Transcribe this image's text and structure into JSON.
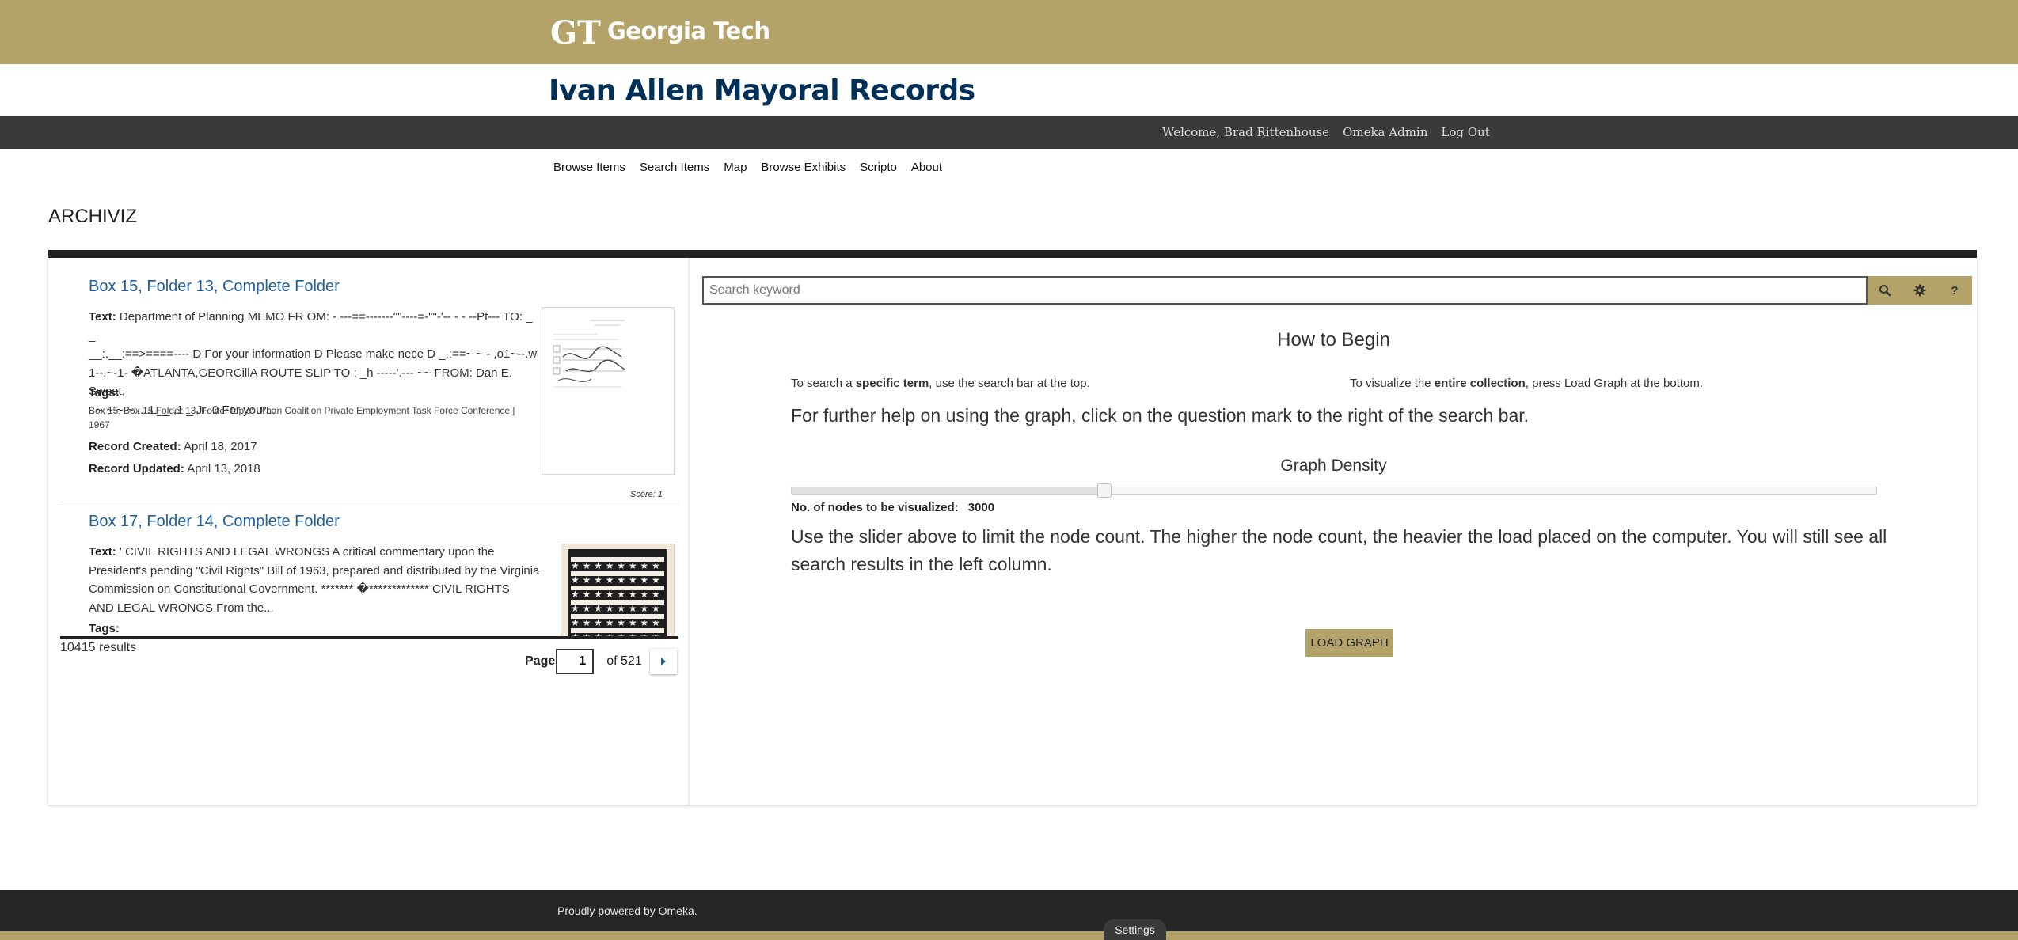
{
  "banner": {
    "logo_text": "Georgia Tech",
    "logo_mark": "GT"
  },
  "site": {
    "title": "Ivan Allen Mayoral Records"
  },
  "user_bar": {
    "welcome": "Welcome, Brad Rittenhouse",
    "admin": "Omeka Admin",
    "logout": "Log Out"
  },
  "nav": [
    "Browse Items",
    "Search Items",
    "Map",
    "Browse Exhibits",
    "Scripto",
    "About"
  ],
  "app": {
    "title": "ARCHIVIZ"
  },
  "results": [
    {
      "title": "Box 15, Folder 13, Complete Folder",
      "text_label": "Text:",
      "text_lines": [
        "Department of Planning MEMO FR OM: - ---==-------\"\"----=-\"\"-'-- - - --Pt--- TO: _ _",
        "__:.__:==>====---- D For your information D Please make nece D _.:==~ ~ - ,o1~--.w",
        "1--.~-1- �ATLANTA,GEORCillA ROUTE SLIP TO : _h -----'.--- ~~ FROM: Dan E. Sweat,",
        "- ~ ~ ~ ~ ....L__ ,1 _ Jr. 0 For your..."
      ],
      "tags_label": "Tags:",
      "tags_lines": [
        "Box 15, Box 15 Folder 13, Folder topic: Urban Coalition Private Employment Task Force Conference |",
        "1967"
      ],
      "created_label": "Record Created:",
      "created": "April 18, 2017",
      "updated_label": "Record Updated:",
      "updated": "April 13, 2018",
      "score": "Score: 1"
    },
    {
      "title": "Box 17, Folder 14, Complete Folder",
      "text_label": "Text:",
      "text_lines": [
        "' CIVIL RIGHTS AND LEGAL WRONGS A critical commentary upon the",
        "President's pending \"Civil Rights\" Bill of 1963, prepared and distributed by the Virginia",
        "Commission on Constitutional Government. ******* �************* CIVIL RIGHTS",
        "AND LEGAL WRONGS From the..."
      ],
      "tags_label": "Tags:"
    }
  ],
  "results_summary": {
    "count": "10415 results"
  },
  "pager": {
    "label": "Page",
    "current": "1",
    "of": "of 521"
  },
  "search": {
    "placeholder": "Search keyword",
    "search_icon": "search-icon",
    "settings_icon": "gear-icon",
    "help_label": "?"
  },
  "how_to_begin": {
    "title": "How to Begin",
    "hint_left_pre": "To search a ",
    "hint_left_bold": "specific term",
    "hint_left_post": ", use the search bar at the top.",
    "hint_right_pre": "To visualize the ",
    "hint_right_bold": "entire collection",
    "hint_right_post": ", press Load Graph at the bottom.",
    "help_line": "For further help on using the graph, click on the question mark to the right of the search bar."
  },
  "graph_density": {
    "label": "Graph Density",
    "nodes_label": "No. of nodes to be visualized:",
    "nodes_value": "3000",
    "slider_fraction": 0.288,
    "help": "Use the slider above to limit the node count. The higher the node count, the heavier the load placed on the computer. You will still see all search results in the left column."
  },
  "load_button": "LOAD GRAPH",
  "footer": {
    "powered_pre": "Proudly powered by ",
    "powered_link": "Omeka",
    "powered_post": ".",
    "settings": "Settings"
  },
  "colors": {
    "gold": "#b3a369",
    "navy": "#003057",
    "link": "#1f5f9a",
    "dark_bar": "#3a3a3a",
    "footer": "#262626"
  }
}
